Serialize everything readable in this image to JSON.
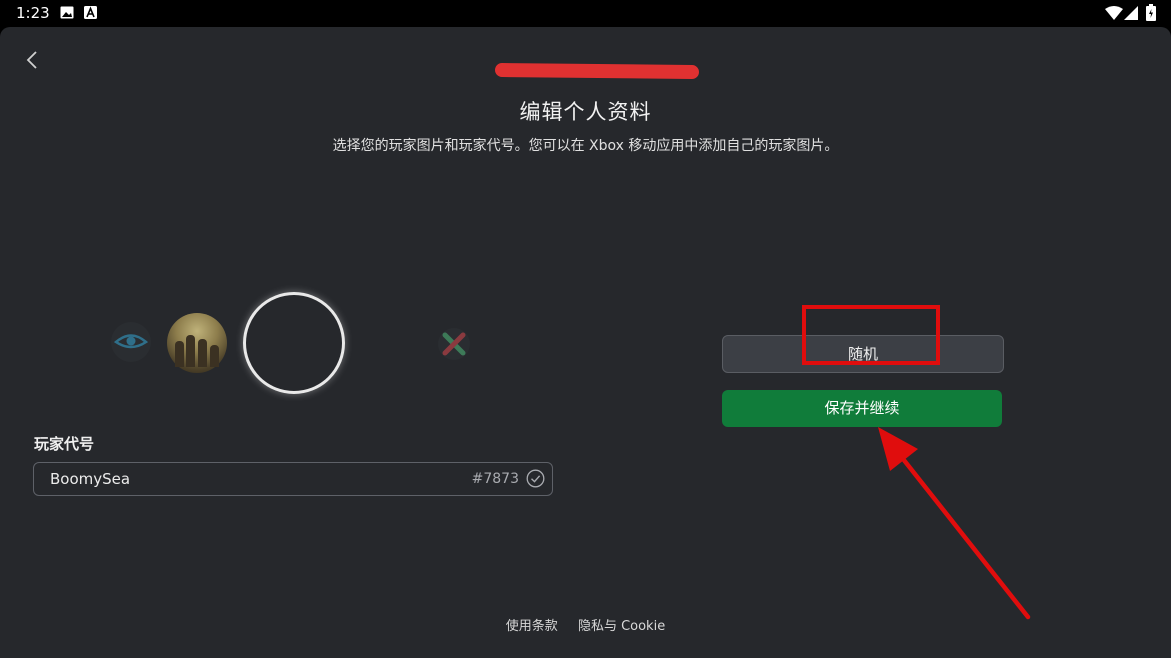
{
  "status_bar": {
    "time": "1:23"
  },
  "header": {
    "title": "编辑个人资料",
    "subtitle": "选择您的玩家图片和玩家代号。您可以在 Xbox 移动应用中添加自己的玩家图片。"
  },
  "picker": {
    "items": [
      "eye-picture",
      "group-photo-picture",
      "selected-empty-picture",
      "crossed-x-picture"
    ]
  },
  "gamertag": {
    "label": "玩家代号",
    "value": "BoomySea",
    "suffix": "#7873"
  },
  "actions": {
    "random_label": "随机",
    "save_label": "保存并继续"
  },
  "footer": {
    "terms": "使用条款",
    "privacy": "隐私与 Cookie"
  },
  "colors": {
    "background": "#26282c",
    "save_button": "#107c3a",
    "annotation": "#e00d0d"
  }
}
